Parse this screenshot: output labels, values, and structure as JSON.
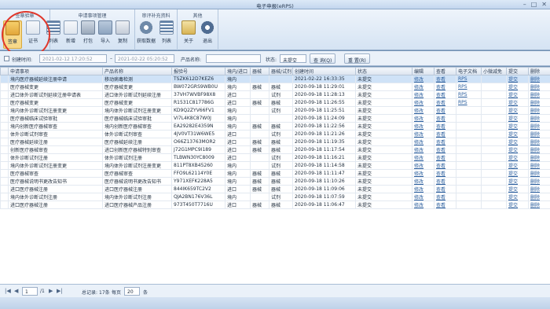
{
  "window": {
    "title": "电子申报(eRPS)"
  },
  "ribbon": {
    "groups": [
      {
        "title": "签章验章",
        "tools": [
          "签章",
          "证书"
        ]
      },
      {
        "title": "申请事项管理",
        "tools": [
          "列表",
          "新增",
          "打包",
          "导入",
          "复制"
        ]
      },
      {
        "title": "审评补充资料",
        "tools": [
          "获取数据",
          "列表"
        ]
      },
      {
        "title": "其他",
        "tools": [
          "关于",
          "退出"
        ]
      }
    ]
  },
  "filter": {
    "created_label": "创建时间:",
    "start": "2021-02-12 17:20:52",
    "end": "2021-02-22 05:20:52",
    "product_label": "产品名称:",
    "product_value": "",
    "status_label": "状态:",
    "status_value": "未提交",
    "search_btn": "查 询(Q)",
    "reset_btn": "重 置(R)"
  },
  "table": {
    "columns": [
      "申请事项",
      "产品名称",
      "报验号",
      "境内/进口",
      "器械",
      "器械/试剂",
      "创建时间",
      "状态",
      "编辑",
      "查看",
      "电子文档",
      "小微减免",
      "提交",
      "删除"
    ],
    "rows": [
      [
        "境内医疗器械延续注册申请",
        "移动病毒检测",
        "TSZK612D7KEZ6",
        "境内",
        "",
        "",
        "2021-02-22 16:33:35",
        "未提交",
        "修改",
        "查看",
        "RPS",
        "",
        "提交",
        "删除"
      ],
      [
        "医疗器械变更",
        "医疗器械变更",
        "BW072GRS9WB0U",
        "境内",
        "器械",
        "器械",
        "2020-09-18 11:29:01",
        "未提交",
        "修改",
        "查看",
        "RPS",
        "",
        "提交",
        "删除"
      ],
      [
        "进口体外诊断试剂延续注册申请表",
        "进口体外诊断试剂延续注册",
        "37VH7WVBF98X8",
        "进口",
        "",
        "试剂",
        "2020-09-18 11:28:13",
        "未提交",
        "修改",
        "查看",
        "RPS",
        "",
        "提交",
        "删除"
      ],
      [
        "医疗器械变更",
        "医疗器械变更",
        "R1531C817786G",
        "进口",
        "器械",
        "器械",
        "2020-09-18 11:26:55",
        "未提交",
        "修改",
        "查看",
        "RPS",
        "",
        "提交",
        "删除"
      ],
      [
        "境内体外诊断试剂注册变更",
        "境内体外诊断试剂注册变更",
        "KD9Q2ZYV66FV1",
        "境内",
        "",
        "试剂",
        "2020-09-18 11:25:51",
        "未提交",
        "修改",
        "查看",
        "",
        "",
        "提交",
        "删除"
      ],
      [
        "医疗器械临床试验审批",
        "医疗器械临床试验审批",
        "VI7L4K8C87W0J",
        "境内",
        "",
        "",
        "2020-09-18 11:24:09",
        "未提交",
        "修改",
        "查看",
        "",
        "",
        "提交",
        "删除"
      ],
      [
        "境内创新医疗器械审查",
        "境内创新医疗器械审查",
        "EA29282E4359N",
        "境内",
        "器械",
        "器械",
        "2020-09-18 11:22:56",
        "未提交",
        "修改",
        "查看",
        "",
        "",
        "提交",
        "删除"
      ],
      [
        "体外诊断试剂审查",
        "体外诊断试剂审查",
        "4JV0VT31W6WE5",
        "进口",
        "",
        "试剂",
        "2020-09-18 11:21:26",
        "未提交",
        "修改",
        "查看",
        "",
        "",
        "提交",
        "删除"
      ],
      [
        "医疗器械延续注册",
        "医疗器械延续注册",
        "O66Z13763MOR2",
        "进口",
        "器械",
        "器械",
        "2020-09-18 11:19:35",
        "未提交",
        "修改",
        "查看",
        "",
        "",
        "提交",
        "删除"
      ],
      [
        "创新医疗器械审查",
        "进口创新医疗器械特别审查",
        "J72G1MPC9I189",
        "进口",
        "器械",
        "器械",
        "2020-09-18 11:17:54",
        "未提交",
        "修改",
        "查看",
        "",
        "",
        "提交",
        "删除"
      ],
      [
        "体外诊断试剂注册",
        "体外诊断试剂注册",
        "TLBWN30YC8009",
        "进口",
        "",
        "试剂",
        "2020-09-18 11:16:21",
        "未提交",
        "修改",
        "查看",
        "",
        "",
        "提交",
        "删除"
      ],
      [
        "境内体外诊断试剂注册变更",
        "境内体外诊断试剂注册变更",
        "811PT8XB45260",
        "境内",
        "",
        "试剂",
        "2020-09-18 11:14:58",
        "未提交",
        "修改",
        "查看",
        "",
        "",
        "提交",
        "删除"
      ],
      [
        "医疗器械审查",
        "医疗器械审查",
        "FFO9L62114Y0E",
        "境内",
        "器械",
        "器械",
        "2020-09-18 11:11:47",
        "未提交",
        "修改",
        "查看",
        "",
        "",
        "提交",
        "删除"
      ],
      [
        "医疗器械说明书更改告知书",
        "医疗器械说明书更改告知书",
        "Y971XEFK228A5",
        "境内",
        "器械",
        "器械",
        "2020-09-18 11:10:26",
        "未提交",
        "修改",
        "查看",
        "",
        "",
        "提交",
        "删除"
      ],
      [
        "进口医疗器械注册",
        "进口医疗器械注册",
        "844IK659TC2V2",
        "进口",
        "器械",
        "器械",
        "2020-09-18 11:09:06",
        "未提交",
        "修改",
        "查看",
        "",
        "",
        "提交",
        "删除"
      ],
      [
        "境内体外诊断试剂注册",
        "境内体外诊断试剂注册",
        "QJA2BN176V36L",
        "境内",
        "",
        "试剂",
        "2020-09-18 11:07:59",
        "未提交",
        "修改",
        "查看",
        "",
        "",
        "提交",
        "删除"
      ],
      [
        "进口医疗器械注册",
        "进口医疗器械产品注册",
        "973T450T7716U",
        "进口",
        "器械",
        "器械",
        "2020-09-18 11:06:47",
        "未提交",
        "修改",
        "查看",
        "",
        "",
        "提交",
        "删除"
      ]
    ]
  },
  "pager": {
    "page": "1",
    "of": "/1",
    "total_label": "总记录:",
    "total": "17条",
    "per_label": "每页",
    "per": "20",
    "unit": "条"
  }
}
